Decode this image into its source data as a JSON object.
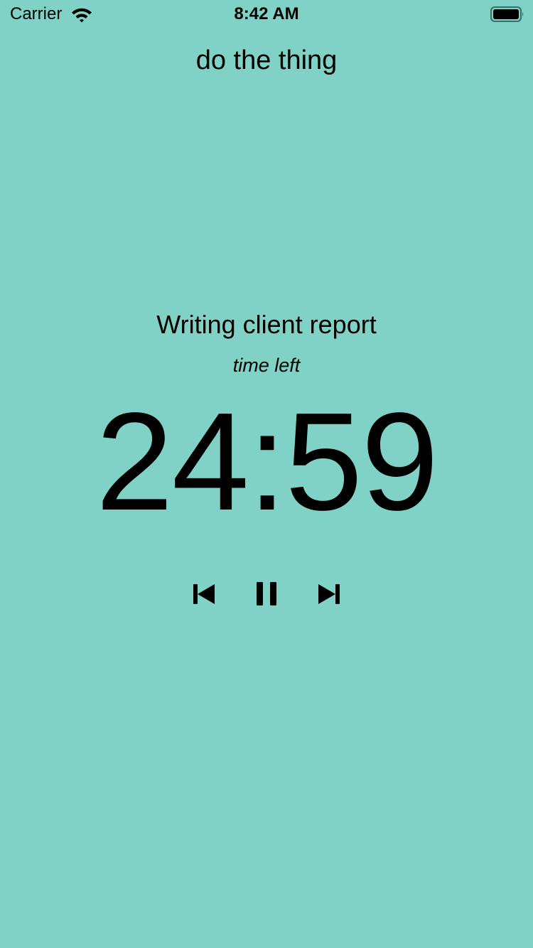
{
  "status_bar": {
    "carrier": "Carrier",
    "time": "8:42 AM",
    "wifi_icon": "wifi-icon",
    "battery_icon": "battery-icon",
    "battery_level": 1.0
  },
  "app": {
    "title": "do the thing",
    "background_color": "#80d1c6"
  },
  "task": {
    "name": "Writing client report",
    "time_caption": "time left",
    "remaining": "24:59"
  },
  "controls": [
    {
      "name": "previous",
      "icon": "skip-back-icon"
    },
    {
      "name": "pause",
      "icon": "pause-icon"
    },
    {
      "name": "next",
      "icon": "skip-forward-icon"
    }
  ]
}
